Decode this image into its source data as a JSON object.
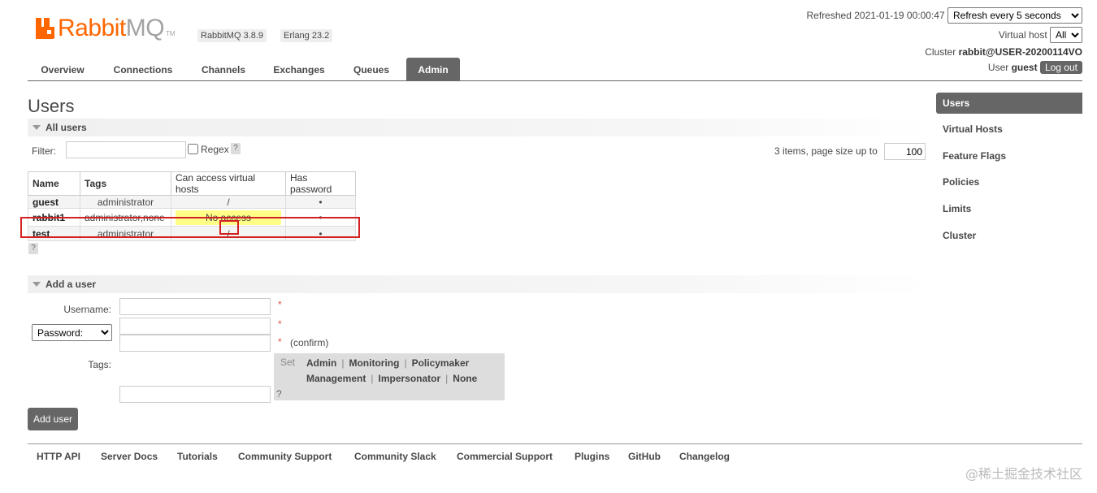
{
  "brand": {
    "rabbit": "Rabbit",
    "mq": "MQ",
    "tm": "TM",
    "version": "RabbitMQ 3.8.9",
    "erlang": "Erlang 23.2"
  },
  "header": {
    "refreshed": "Refreshed 2021-01-19 00:00:47",
    "refresh_option": "Refresh every 5 seconds",
    "vhost_label": "Virtual host",
    "vhost_option": "All",
    "cluster_label": "Cluster",
    "cluster_name": "rabbit@USER-20200114VO",
    "user_label": "User",
    "user_name": "guest",
    "logout": "Log out"
  },
  "tabs": [
    "Overview",
    "Connections",
    "Channels",
    "Exchanges",
    "Queues",
    "Admin"
  ],
  "page_title": "Users",
  "all_users": {
    "header": "All users",
    "filter_label": "Filter:",
    "filter_value": "",
    "regex_label": "Regex",
    "help": "?",
    "items_text": "3 items, page size up to",
    "page_size": "100",
    "columns": [
      "Name",
      "Tags",
      "Can access virtual hosts",
      "Has password"
    ],
    "rows": [
      {
        "name": "guest",
        "tags": "administrator",
        "vhosts": "/",
        "password": "•"
      },
      {
        "name": "rabbit1",
        "tags": "administrator,none",
        "vhosts": "No access",
        "password": "•"
      },
      {
        "name": "test",
        "tags": "administrator",
        "vhosts": "/",
        "password": "•"
      }
    ]
  },
  "add_user": {
    "header": "Add a user",
    "username_label": "Username:",
    "password_option": "Password:",
    "required": "*",
    "confirm": "(confirm)",
    "tags_label": "Tags:",
    "set_label": "Set",
    "tag_options_row1": [
      "Admin",
      "Monitoring",
      "Policymaker"
    ],
    "tag_options_row2": [
      "Management",
      "Impersonator",
      "None"
    ],
    "separator": "|",
    "help": "?",
    "button": "Add user"
  },
  "sidebar": [
    "Users",
    "Virtual Hosts",
    "Feature Flags",
    "Policies",
    "Limits",
    "Cluster"
  ],
  "footer": [
    "HTTP API",
    "Server Docs",
    "Tutorials",
    "Community Support",
    "Community Slack",
    "Commercial Support",
    "Plugins",
    "GitHub",
    "Changelog"
  ],
  "watermark": "@稀土掘金技术社区"
}
